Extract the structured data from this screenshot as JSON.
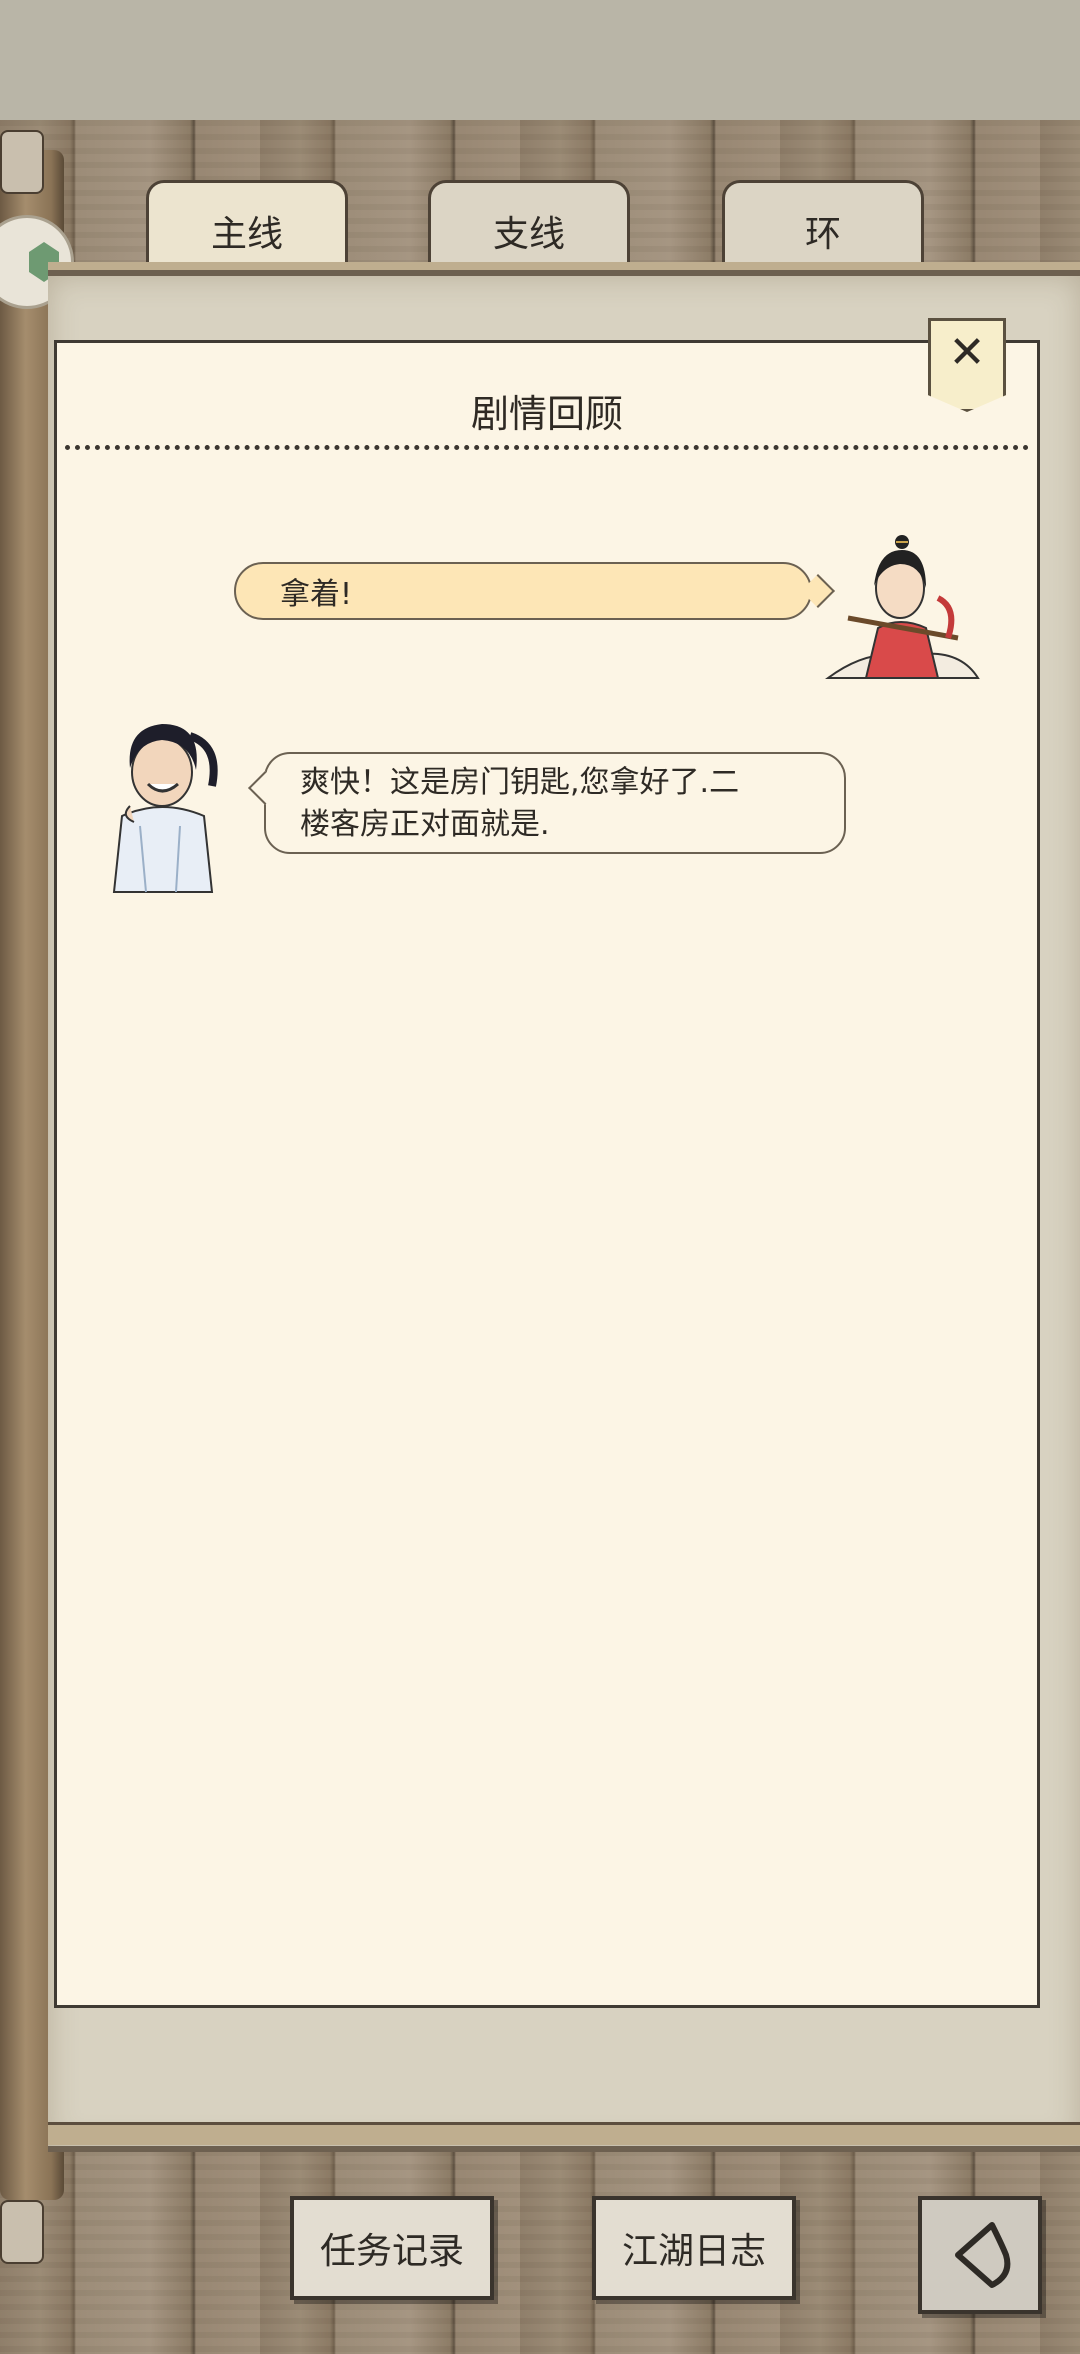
{
  "tabs": [
    {
      "label": "主线",
      "active": true
    },
    {
      "label": "支线",
      "active": false
    },
    {
      "label": "环",
      "active": false
    }
  ],
  "panel": {
    "title": "剧情回顾",
    "close_icon": "close-icon"
  },
  "dialogue": [
    {
      "side": "right",
      "text": "拿着!",
      "speaker_icon": "swordswoman-avatar"
    },
    {
      "side": "left",
      "text_line1": "爽快！这是房门钥匙,您拿好了.二",
      "text_line2": "楼客房正对面就是.",
      "speaker_icon": "innkeeper-avatar"
    }
  ],
  "footer": {
    "task_record": "任务记录",
    "jianghu_journal": "江湖日志",
    "back_icon": "back-arrow-icon"
  },
  "colors": {
    "paper": "#fcf5e5",
    "bubble_highlight": "#fde6b6",
    "wood": "#9a8a74"
  }
}
